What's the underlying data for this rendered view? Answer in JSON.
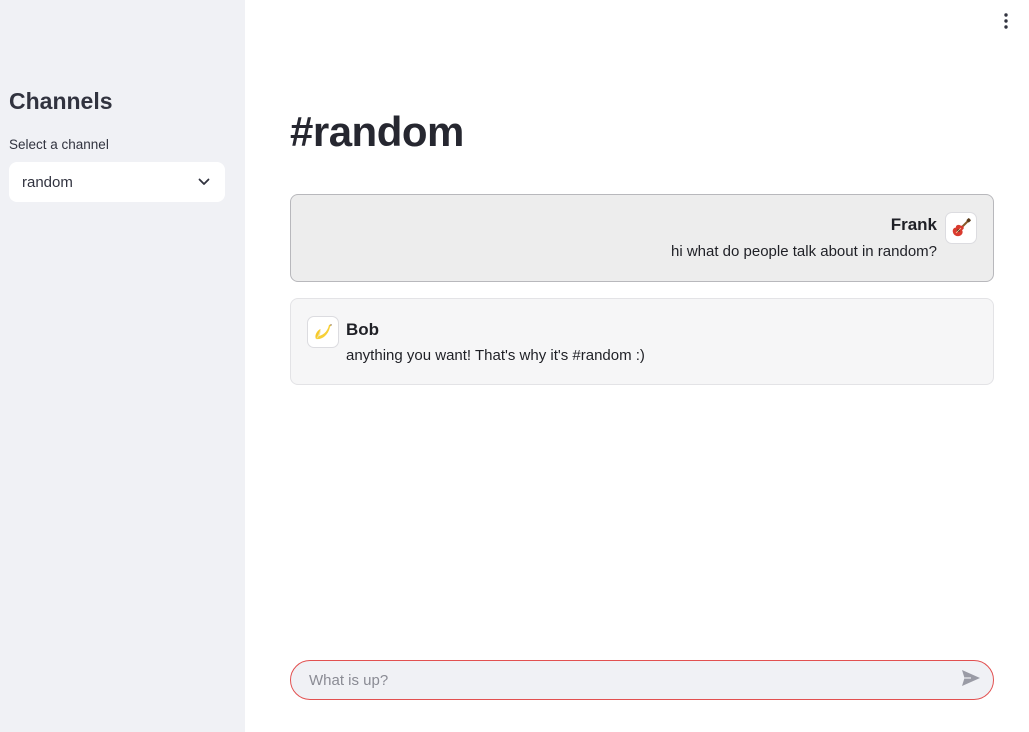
{
  "sidebar": {
    "title": "Channels",
    "select_label": "Select a channel",
    "selected_channel": "random"
  },
  "main": {
    "title": "#random"
  },
  "messages": [
    {
      "role": "user",
      "name": "Frank",
      "text": "hi what do people talk about in random?",
      "avatar": "guitar-icon"
    },
    {
      "role": "assistant",
      "name": "Bob",
      "text": "anything you want! That's why it's #random :)",
      "avatar": "banana-icon"
    }
  ],
  "chat_input": {
    "placeholder": "What is up?",
    "value": ""
  },
  "colors": {
    "sidebar_bg": "#f0f1f5",
    "accent_border": "#e25050",
    "user_msg_bg": "#ededed",
    "assistant_msg_bg": "#f6f6f7"
  }
}
